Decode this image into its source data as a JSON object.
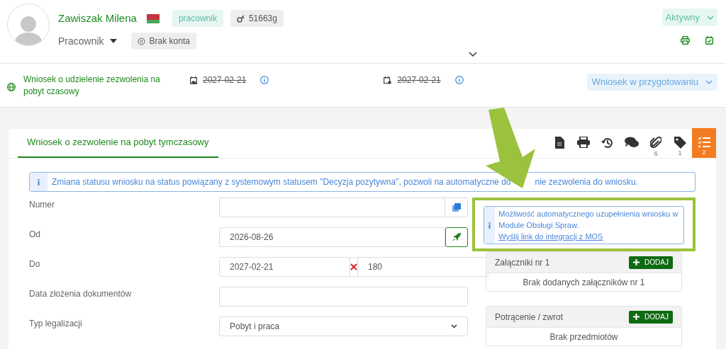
{
  "profile": {
    "name": "Zawiszak Milena",
    "role_tag": "pracownik",
    "id_tag": "51663g",
    "role": "Pracownik",
    "account": "Brak konta",
    "status": "Aktywny"
  },
  "application": {
    "title": "Wniosek o udzielenie zezwolenia na pobyt czasowy",
    "date_1": "2027-02-21",
    "date_2": "2027-02-21",
    "status": "Wniosek w przygotowaniu"
  },
  "tabs": [
    {
      "label": "Wniosek o zezwolenie na pobyt tymczasowy",
      "selected": true
    }
  ],
  "toolbar": [
    {
      "kind": "document"
    },
    {
      "kind": "print"
    },
    {
      "kind": "history"
    },
    {
      "kind": "comments"
    },
    {
      "kind": "attachments",
      "count": "6"
    },
    {
      "kind": "tags",
      "count": "1"
    },
    {
      "kind": "checklist",
      "count": "2",
      "active": true
    }
  ],
  "banner": {
    "text_before": "Zmiana statusu wniosku na status powiązany z systemowym statusem \"Decyzja pozytywna\", pozwoli na automatyczne do",
    "text_after": "nie zezwolenia do wniosku."
  },
  "fields": [
    {
      "label": "Numer",
      "kind": "copy"
    },
    {
      "label": "Od",
      "kind": "action",
      "value": "2026-08-26"
    },
    {
      "label": "Do",
      "kind": "days",
      "value": "2027-02-21",
      "days": "180"
    },
    {
      "label": "Data złożenia dokumentów",
      "kind": "text"
    },
    {
      "label": "Typ legalizacji",
      "kind": "select",
      "value": "Pobyt i praca"
    }
  ],
  "mos": {
    "text": "Możliwość automatycznego uzupełnienia wniosku w Module Obsługi Spraw.",
    "link": "Wyślij link do integracji z MOS"
  },
  "panels": [
    {
      "title": "Załączniki nr 1",
      "button": "DODAJ",
      "empty": "Brak dodanych załączników nr 1"
    },
    {
      "title": "Potrącenie / zwrot",
      "button": "DODAJ",
      "empty": "Brak przedmiotów"
    }
  ]
}
